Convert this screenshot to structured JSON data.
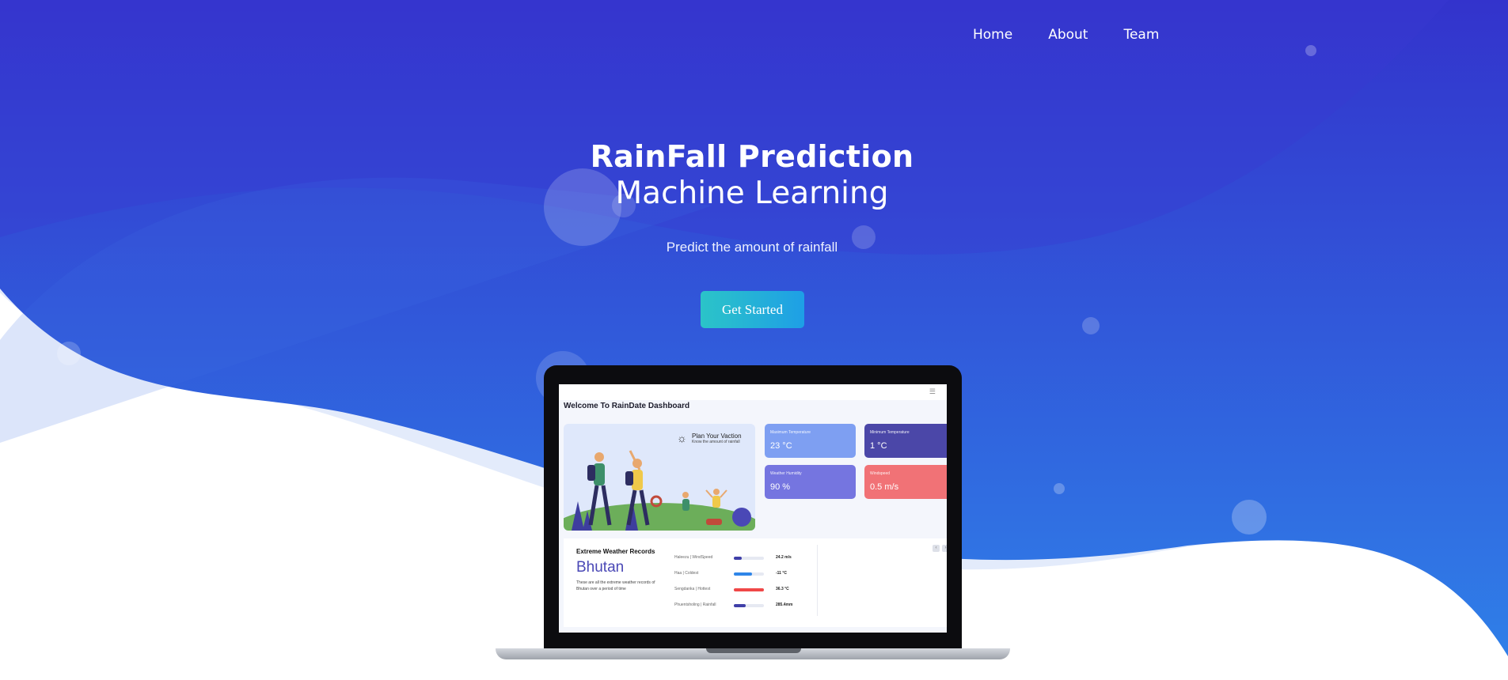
{
  "nav": {
    "items": [
      "Home",
      "About",
      "Team"
    ]
  },
  "hero": {
    "title_bold": "RainFall Prediction",
    "title_light": "Machine Learning",
    "subtitle": "Predict the amount of rainfall",
    "cta_label": "Get Started"
  },
  "colors": {
    "hero_top": "#3333cc",
    "hero_bottom": "#2f7fe8",
    "cta_start": "#2bc4c8",
    "cta_end": "#1e9fe6"
  },
  "dashboard": {
    "menu_icon": "hamburger-icon",
    "title": "Welcome To RainDate Dashboard",
    "promo": {
      "heading": "Plan Your Vaction",
      "sub": "Know the amount of rainfall",
      "icon": "sun-icon"
    },
    "cards": [
      {
        "label": "Maximum Temperature",
        "value": "23 °C",
        "color": "#7e9ff2"
      },
      {
        "label": "Minimum Temperature",
        "value": "1 °C",
        "color": "#4b47a8"
      },
      {
        "label": "Weather Humidity",
        "value": "90 %",
        "color": "#7575e0"
      },
      {
        "label": "Windspeed",
        "value": "0.5 m/s",
        "color": "#f17276"
      }
    ],
    "records": {
      "title": "Extreme Weather Records",
      "country": "Bhutan",
      "description": "These are all the extreme weather records of Bhutan over a period of time",
      "rows": [
        {
          "name": "Haleezu | WindSpeed",
          "value": "24.2 m/s",
          "fraction": 0.25,
          "color": "#3f3fa8"
        },
        {
          "name": "Haa | Coldest",
          "value": "-11 °C",
          "fraction": 0.6,
          "color": "#2f86e8"
        },
        {
          "name": "Sengdanka | Hottest",
          "value": "36.3 °C",
          "fraction": 1.0,
          "color": "#f04848"
        },
        {
          "name": "Phuentsholing | Rainfall",
          "value": "285.4mm",
          "fraction": 0.4,
          "color": "#3f3fa8"
        }
      ]
    }
  }
}
